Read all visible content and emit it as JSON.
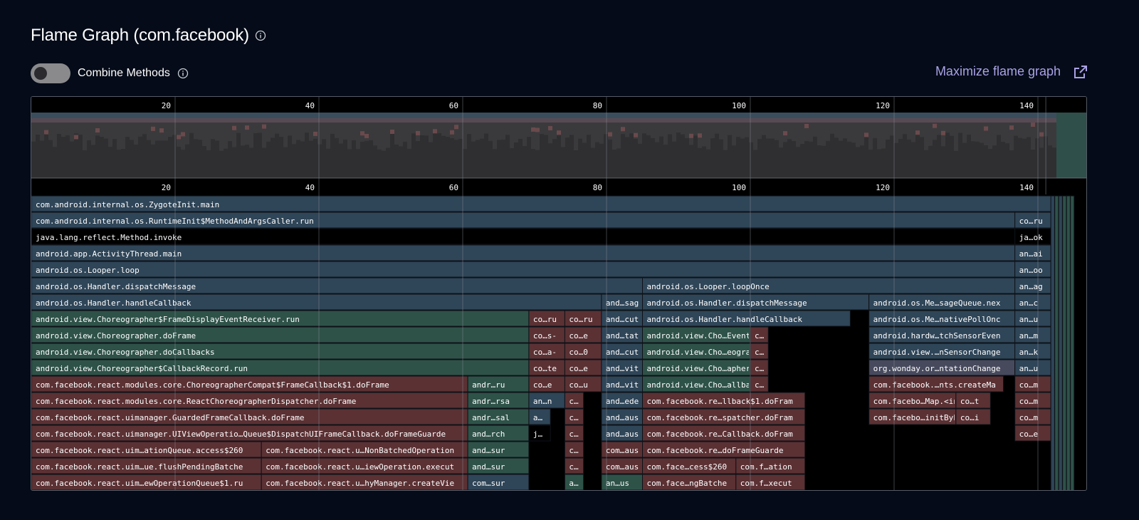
{
  "header": {
    "title": "Flame Graph (com.facebook)",
    "info_icon": "info-icon"
  },
  "controls": {
    "combine_label": "Combine Methods",
    "combine_enabled": false,
    "maximize_label": "Maximize flame graph",
    "maximize_icon": "external-link-icon"
  },
  "colors": {
    "background": "#050b18",
    "accent": "#a9a2e6",
    "frame_blue": "#2f4558",
    "frame_green": "#2e5248",
    "frame_red": "#5b3134",
    "frame_black": "#000000",
    "frame_purple": "#474a5d"
  },
  "flame": {
    "ticks": [
      "20",
      "40",
      "60",
      "80",
      "100",
      "120",
      "140"
    ],
    "rows": [
      [
        {
          "label": "com.android.internal.os.ZygoteInit.main",
          "start": 0,
          "end": 143.2,
          "color": "blue"
        }
      ],
      [
        {
          "label": "com.android.internal.os.RuntimeInit$MethodAndArgsCaller.run",
          "start": 0,
          "end": 136.8,
          "color": "blue"
        },
        {
          "label": "co…ru",
          "start": 136.8,
          "end": 141.8,
          "color": "blue"
        }
      ],
      [
        {
          "label": "java.lang.reflect.Method.invoke",
          "start": 0,
          "end": 136.8,
          "color": "black"
        },
        {
          "label": "ja…ok",
          "start": 136.8,
          "end": 141.8,
          "color": "black"
        }
      ],
      [
        {
          "label": "android.app.ActivityThread.main",
          "start": 0,
          "end": 136.8,
          "color": "blue"
        },
        {
          "label": "an…ai",
          "start": 136.8,
          "end": 141.8,
          "color": "blue"
        }
      ],
      [
        {
          "label": "android.os.Looper.loop",
          "start": 0,
          "end": 136.8,
          "color": "blue"
        },
        {
          "label": "an…oo",
          "start": 136.8,
          "end": 141.8,
          "color": "blue"
        }
      ],
      [
        {
          "label": "android.os.Handler.dispatchMessage",
          "start": 0,
          "end": 85,
          "color": "blue"
        },
        {
          "label": "android.os.Looper.loopOnce",
          "start": 85,
          "end": 136.8,
          "color": "blue"
        },
        {
          "label": "an…ag",
          "start": 136.8,
          "end": 141.8,
          "color": "blue"
        }
      ],
      [
        {
          "label": "android.os.Handler.handleCallback",
          "start": 0,
          "end": 79.3,
          "color": "blue"
        },
        {
          "label": "and…sag",
          "start": 79.3,
          "end": 85,
          "color": "blue"
        },
        {
          "label": "android.os.Handler.dispatchMessage",
          "start": 85,
          "end": 116.5,
          "color": "blue"
        },
        {
          "label": "android.os.Me…sageQueue.nex",
          "start": 116.5,
          "end": 136.8,
          "color": "blue"
        },
        {
          "label": "an…c",
          "start": 136.8,
          "end": 141.8,
          "color": "blue"
        }
      ],
      [
        {
          "label": "android.view.Choreographer$FrameDisplayEventReceiver.run",
          "start": 0,
          "end": 69.2,
          "color": "green"
        },
        {
          "label": "co…ru",
          "start": 69.2,
          "end": 74.2,
          "color": "red"
        },
        {
          "label": "co…ru",
          "start": 74.2,
          "end": 79.3,
          "color": "red"
        },
        {
          "label": "and…cut",
          "start": 79.3,
          "end": 85,
          "color": "blue"
        },
        {
          "label": "android.os.Handler.handleCallback",
          "start": 85,
          "end": 113.9,
          "color": "blue"
        },
        {
          "label": "android.os.Me…nativePollOnc",
          "start": 116.5,
          "end": 136.8,
          "color": "blue"
        },
        {
          "label": "an…u",
          "start": 136.8,
          "end": 141.8,
          "color": "blue"
        }
      ],
      [
        {
          "label": "android.view.Choreographer.doFrame",
          "start": 0,
          "end": 69.2,
          "color": "green"
        },
        {
          "label": "co…s-",
          "start": 69.2,
          "end": 74.2,
          "color": "red"
        },
        {
          "label": "co…e",
          "start": 74.2,
          "end": 79.3,
          "color": "red"
        },
        {
          "label": "and…tat",
          "start": 79.3,
          "end": 85,
          "color": "blue"
        },
        {
          "label": "android.view.Cho…EventReceiver.ru",
          "start": 85,
          "end": 100,
          "color": "green"
        },
        {
          "label": "c…",
          "start": 100,
          "end": 102.5,
          "color": "red"
        },
        {
          "label": "android.hardw…tchSensorEven",
          "start": 116.5,
          "end": 136.8,
          "color": "blue"
        },
        {
          "label": "an…m",
          "start": 136.8,
          "end": 141.8,
          "color": "blue"
        }
      ],
      [
        {
          "label": "android.view.Choreographer.doCallbacks",
          "start": 0,
          "end": 69.2,
          "color": "green"
        },
        {
          "label": "co…a-",
          "start": 69.2,
          "end": 74.2,
          "color": "red"
        },
        {
          "label": "co…0",
          "start": 74.2,
          "end": 79.3,
          "color": "red"
        },
        {
          "label": "and…cut",
          "start": 79.3,
          "end": 85,
          "color": "blue"
        },
        {
          "label": "android.view.Cho…eographer.doFram",
          "start": 85,
          "end": 100,
          "color": "green"
        },
        {
          "label": "c…",
          "start": 100,
          "end": 102.5,
          "color": "red"
        },
        {
          "label": "android.view.…nSensorChange",
          "start": 116.5,
          "end": 136.8,
          "color": "blue"
        },
        {
          "label": "an…k",
          "start": 136.8,
          "end": 141.8,
          "color": "blue"
        }
      ],
      [
        {
          "label": "android.view.Choreographer$CallbackRecord.run",
          "start": 0,
          "end": 69.2,
          "color": "green"
        },
        {
          "label": "co…te",
          "start": 69.2,
          "end": 74.2,
          "color": "red"
        },
        {
          "label": "co…e",
          "start": 74.2,
          "end": 79.3,
          "color": "red"
        },
        {
          "label": "and…vit",
          "start": 79.3,
          "end": 85,
          "color": "blue"
        },
        {
          "label": "android.view.Cho…apher.doCallback",
          "start": 85,
          "end": 100,
          "color": "green"
        },
        {
          "label": "c…",
          "start": 100,
          "end": 102.5,
          "color": "red"
        },
        {
          "label": "org.wonday.or…ntationChange",
          "start": 116.5,
          "end": 136.8,
          "color": "purple"
        },
        {
          "label": "an…u",
          "start": 136.8,
          "end": 141.8,
          "color": "blue"
        }
      ],
      [
        {
          "label": "com.facebook.react.modules.core.ChoreographerCompat$FrameCallback$1.doFrame",
          "start": 0,
          "end": 60.7,
          "color": "red"
        },
        {
          "label": "andr…ru",
          "start": 60.7,
          "end": 69.2,
          "color": "green"
        },
        {
          "label": "co…e",
          "start": 69.2,
          "end": 74.2,
          "color": "red"
        },
        {
          "label": "co…u",
          "start": 74.2,
          "end": 79.3,
          "color": "red"
        },
        {
          "label": "and…vit",
          "start": 79.3,
          "end": 85,
          "color": "blue"
        },
        {
          "label": "android.view.Cho…allbackRecord.ru",
          "start": 85,
          "end": 100,
          "color": "green"
        },
        {
          "label": "c…",
          "start": 100,
          "end": 102.5,
          "color": "red"
        },
        {
          "label": "com.facebook.…nts.createMa",
          "start": 116.5,
          "end": 135.2,
          "color": "red"
        },
        {
          "label": "co…m",
          "start": 136.8,
          "end": 141.8,
          "color": "red"
        }
      ],
      [
        {
          "label": "com.facebook.react.modules.core.ReactChoreographerDispatcher.doFrame",
          "start": 0,
          "end": 60.7,
          "color": "red"
        },
        {
          "label": "andr…rsa",
          "start": 60.7,
          "end": 69.2,
          "color": "green"
        },
        {
          "label": "an…n",
          "start": 69.2,
          "end": 74.2,
          "color": "blue"
        },
        {
          "label": "c…",
          "start": 74.2,
          "end": 76.8,
          "color": "red"
        },
        {
          "label": "and…ede",
          "start": 79.3,
          "end": 85,
          "color": "blue"
        },
        {
          "label": "com.facebook.re…llback$1.doFram",
          "start": 85,
          "end": 107.6,
          "color": "red"
        },
        {
          "label": "com.facebo…Map.<init",
          "start": 116.5,
          "end": 128.6,
          "color": "red"
        },
        {
          "label": "co…t",
          "start": 128.6,
          "end": 133.4,
          "color": "red"
        },
        {
          "label": "co…m",
          "start": 136.8,
          "end": 141.8,
          "color": "red"
        }
      ],
      [
        {
          "label": "com.facebook.react.uimanager.GuardedFrameCallback.doFrame",
          "start": 0,
          "end": 60.7,
          "color": "red"
        },
        {
          "label": "andr…sal",
          "start": 60.7,
          "end": 69.2,
          "color": "green"
        },
        {
          "label": "a…",
          "start": 69.2,
          "end": 72.2,
          "color": "blue"
        },
        {
          "label": "c…",
          "start": 74.2,
          "end": 76.8,
          "color": "red"
        },
        {
          "label": "and…aus",
          "start": 79.3,
          "end": 85,
          "color": "blue"
        },
        {
          "label": "com.facebook.re…spatcher.doFram",
          "start": 85,
          "end": 107.6,
          "color": "red"
        },
        {
          "label": "com.facebo…initBybri",
          "start": 116.5,
          "end": 128.6,
          "color": "red"
        },
        {
          "label": "co…i",
          "start": 128.6,
          "end": 133.4,
          "color": "red"
        },
        {
          "label": "co…m",
          "start": 136.8,
          "end": 141.8,
          "color": "red"
        }
      ],
      [
        {
          "label": "com.facebook.react.uimanager.UIViewOperatio…Queue$DispatchUIFrameCallback.doFrameGuarde",
          "start": 0,
          "end": 60.7,
          "color": "red"
        },
        {
          "label": "and…rch",
          "start": 60.7,
          "end": 69.2,
          "color": "green"
        },
        {
          "label": "j…",
          "start": 69.2,
          "end": 72.2,
          "color": "black"
        },
        {
          "label": "c…",
          "start": 74.2,
          "end": 76.8,
          "color": "red"
        },
        {
          "label": "and…aus",
          "start": 79.3,
          "end": 85,
          "color": "blue"
        },
        {
          "label": "com.facebook.re…Callback.doFram",
          "start": 85,
          "end": 107.6,
          "color": "red"
        },
        {
          "label": "co…e",
          "start": 136.8,
          "end": 141.8,
          "color": "red"
        }
      ],
      [
        {
          "label": "com.facebook.react.uim…ationQueue.access$260",
          "start": 0,
          "end": 32,
          "color": "red"
        },
        {
          "label": "com.facebook.react.u…NonBatchedOperation",
          "start": 32,
          "end": 60.7,
          "color": "red"
        },
        {
          "label": "and…sur",
          "start": 60.7,
          "end": 69.2,
          "color": "green"
        },
        {
          "label": "c…",
          "start": 74.2,
          "end": 76.8,
          "color": "red"
        },
        {
          "label": "com…aus",
          "start": 79.3,
          "end": 85,
          "color": "red"
        },
        {
          "label": "com.facebook.re…doFrameGuarde",
          "start": 85,
          "end": 107.6,
          "color": "red"
        }
      ],
      [
        {
          "label": "com.facebook.react.uim…ue.flushPendingBatche",
          "start": 0,
          "end": 32,
          "color": "red"
        },
        {
          "label": "com.facebook.react.u…iewOperation.execut",
          "start": 32,
          "end": 60.7,
          "color": "red"
        },
        {
          "label": "and…sur",
          "start": 60.7,
          "end": 69.2,
          "color": "green"
        },
        {
          "label": "c…",
          "start": 74.2,
          "end": 76.8,
          "color": "red"
        },
        {
          "label": "com…aus",
          "start": 79.3,
          "end": 85,
          "color": "red"
        },
        {
          "label": "com.face…cess$260",
          "start": 85,
          "end": 98,
          "color": "red"
        },
        {
          "label": "com.f…ation",
          "start": 98,
          "end": 107.6,
          "color": "red"
        }
      ],
      [
        {
          "label": "com.facebook.react.uim…ewOperationQueue$1.ru",
          "start": 0,
          "end": 32,
          "color": "red"
        },
        {
          "label": "com.facebook.react.u…hyManager.createVie",
          "start": 32,
          "end": 60.7,
          "color": "red"
        },
        {
          "label": "com…sur",
          "start": 60.7,
          "end": 69.2,
          "color": "blue"
        },
        {
          "label": "a…",
          "start": 74.2,
          "end": 76.8,
          "color": "green"
        },
        {
          "label": "an…us",
          "start": 79.3,
          "end": 85,
          "color": "green"
        },
        {
          "label": "com.face…ngBatche",
          "start": 85,
          "end": 98,
          "color": "red"
        },
        {
          "label": "com.f…xecut",
          "start": 98,
          "end": 107.6,
          "color": "red"
        }
      ]
    ]
  }
}
